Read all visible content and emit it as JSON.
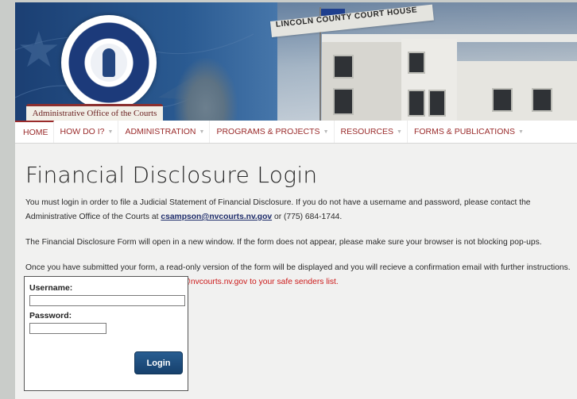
{
  "banner": {
    "tab_label": "Administrative Office of the Courts",
    "building_sign": "LINCOLN COUNTY COURT HOUSE"
  },
  "nav": {
    "items": [
      {
        "label": "HOME",
        "has_dropdown": false
      },
      {
        "label": "HOW DO I?",
        "has_dropdown": true
      },
      {
        "label": "ADMINISTRATION",
        "has_dropdown": true
      },
      {
        "label": "PROGRAMS & PROJECTS",
        "has_dropdown": true
      },
      {
        "label": "RESOURCES",
        "has_dropdown": true
      },
      {
        "label": "FORMS & PUBLICATIONS",
        "has_dropdown": true
      }
    ]
  },
  "page": {
    "title": "Financial Disclosure Login",
    "intro_text": "You must login in order to file a Judicial Statement of Financial Disclosure. If you do not have a username and password, please contact the Administrative Office of the Courts at ",
    "contact_email": "csampson@nvcourts.nv.gov",
    "contact_phone_text": " or (775) 684-1744.",
    "popup_note": "The Financial Disclosure Form will open in a new window. If the form does not appear, please make sure your browser is not blocking pop-ups.",
    "confirmation_note": "Once you have submitted your form, a read-only version of the form will be displayed and you will recieve a confirmation email with further instructions.",
    "safe_senders_note": "Please be sure to add FinancialDisclosures@nvcourts.nv.gov to your safe senders list."
  },
  "login": {
    "username_label": "Username:",
    "username_value": "",
    "password_label": "Password:",
    "password_value": "",
    "submit_label": "Login"
  },
  "colors": {
    "nav_text": "#9a2b2b",
    "safe_senders_text": "#cc1a1a",
    "login_button": "#1e4f80"
  }
}
